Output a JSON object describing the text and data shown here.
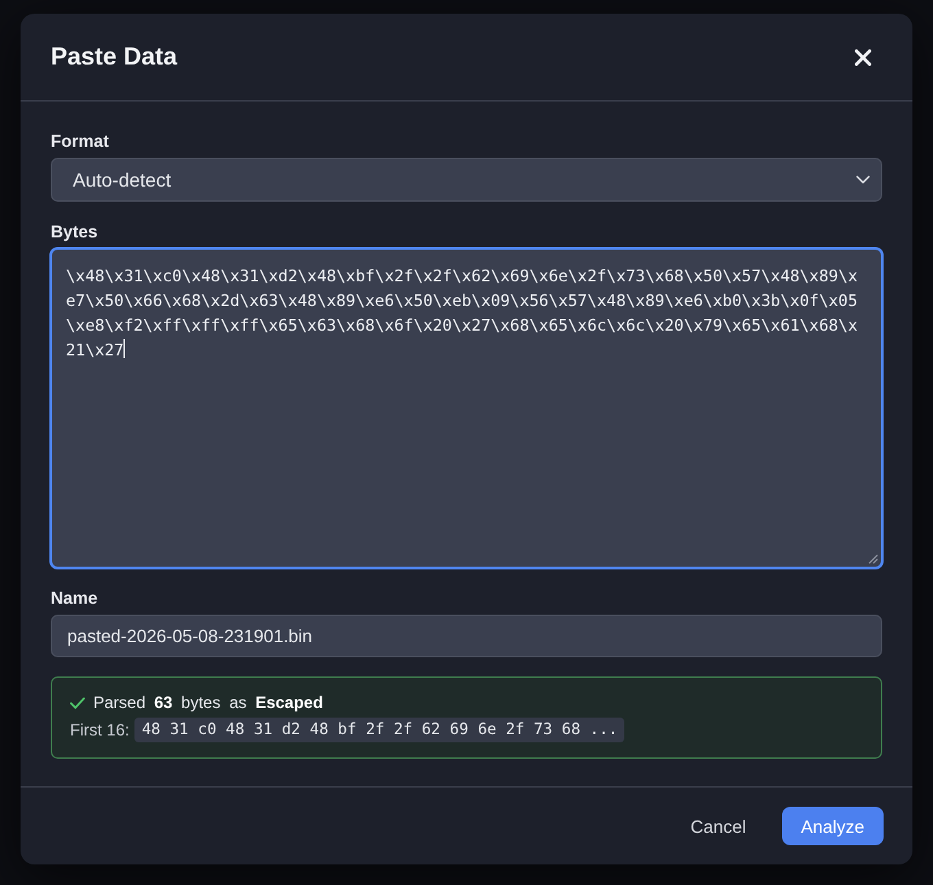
{
  "dialog": {
    "title": "Paste Data"
  },
  "form": {
    "format": {
      "label": "Format",
      "value": "Auto-detect"
    },
    "bytes": {
      "label": "Bytes",
      "value": "\\x48\\x31\\xc0\\x48\\x31\\xd2\\x48\\xbf\\x2f\\x2f\\x62\\x69\\x6e\\x2f\\x73\\x68\\x50\\x57\\x48\\x89\\xe7\\x50\\x66\\x68\\x2d\\x63\\x48\\x89\\xe6\\x50\\xeb\\x09\\x56\\x57\\x48\\x89\\xe6\\xb0\\x3b\\x0f\\x05\\xe8\\xf2\\xff\\xff\\xff\\x65\\x63\\x68\\x6f\\x20\\x27\\x68\\x65\\x6c\\x6c\\x20\\x79\\x65\\x61\\x68\\x21\\x27",
      "focused": true
    },
    "name": {
      "label": "Name",
      "value": "pasted-2026-05-08-231901.bin"
    }
  },
  "status": {
    "kind": "success",
    "message": "Parsed **63** bytes as **Escaped**",
    "preview_label": "First 16:",
    "preview": "48 31 c0 48 31 d2 48 bf 2f 2f 62 69 6e 2f 73 68 ..."
  },
  "buttons": [
    {
      "label": "Cancel",
      "kind": "secondary"
    },
    {
      "label": "Analyze",
      "kind": "primary"
    }
  ]
}
